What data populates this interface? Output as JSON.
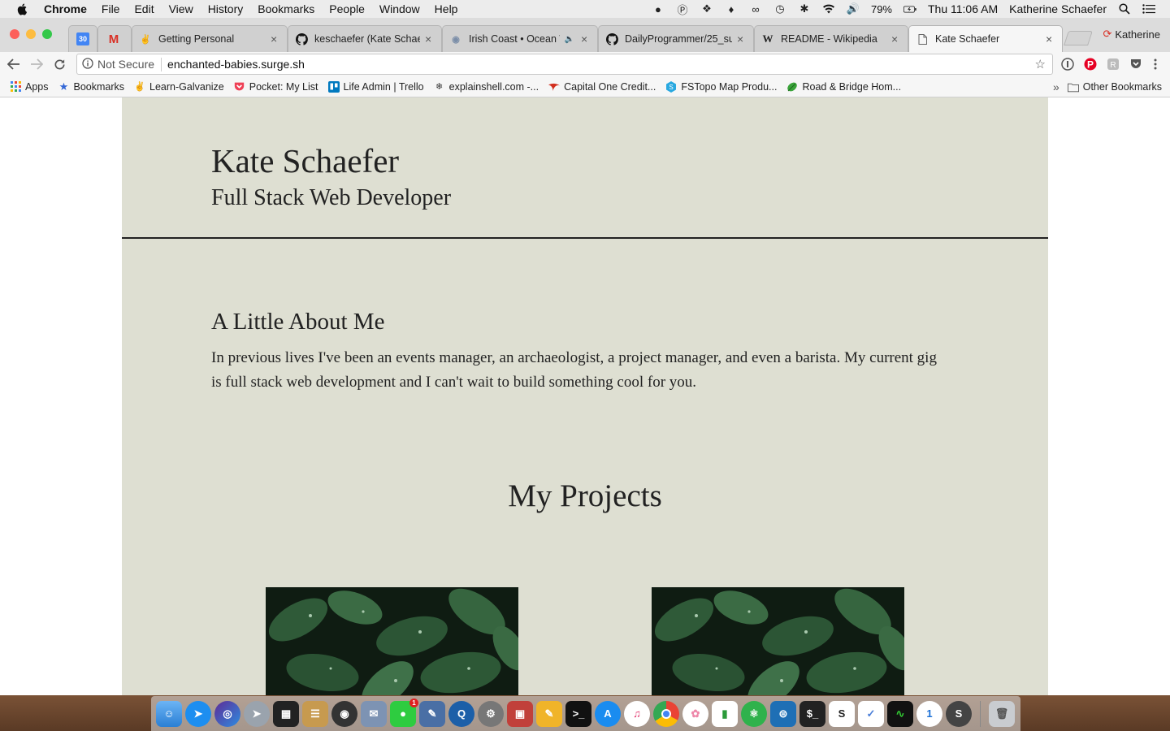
{
  "menubar": {
    "app_name": "Chrome",
    "menus": [
      "File",
      "Edit",
      "View",
      "History",
      "Bookmarks",
      "People",
      "Window",
      "Help"
    ],
    "battery": "79%",
    "clock": "Thu 11:06 AM",
    "user": "Katherine Schaefer"
  },
  "tabs": [
    {
      "label": "",
      "icon": "calendar-icon"
    },
    {
      "label": "",
      "icon": "gmail-icon"
    },
    {
      "label": "Getting Personal",
      "icon": "hand-icon"
    },
    {
      "label": "keschaefer (Kate Schaefer)",
      "icon": "github-icon"
    },
    {
      "label": "Irish Coast • Ocean Waves",
      "icon": "globe-icon"
    },
    {
      "label": "DailyProgrammer/25_su",
      "icon": "github-icon"
    },
    {
      "label": "README - Wikipedia",
      "icon": "wikipedia-icon"
    },
    {
      "label": "Kate Schaefer",
      "icon": "document-icon"
    }
  ],
  "profile_name": "Katherine",
  "omnibox": {
    "security": "Not Secure",
    "url": "enchanted-babies.surge.sh"
  },
  "bookmarks": {
    "items": [
      {
        "label": "Apps",
        "icon": "apps-grid-icon"
      },
      {
        "label": "Bookmarks",
        "icon": "star-icon"
      },
      {
        "label": "Learn-Galvanize",
        "icon": "hand-icon"
      },
      {
        "label": "Pocket: My List",
        "icon": "pocket-icon"
      },
      {
        "label": "Life Admin | Trello",
        "icon": "trello-icon"
      },
      {
        "label": "explainshell.com -...",
        "icon": "shell-icon"
      },
      {
        "label": "Capital One Credit...",
        "icon": "capital-one-icon"
      },
      {
        "label": "FSTopo Map Produ...",
        "icon": "map-icon"
      },
      {
        "label": "Road & Bridge Hom...",
        "icon": "leaf-icon"
      }
    ],
    "overflow": "»",
    "other": "Other Bookmarks"
  },
  "site": {
    "name": "Kate Schaefer",
    "role": "Full Stack Web Developer",
    "about_heading": "A Little About Me",
    "about_text": "In previous lives I've been an events manager, an archaeologist, a project manager, and even a barista. My current gig is full stack web development and I can't wait to build something cool for you.",
    "projects_heading": "My Projects"
  },
  "dock": {
    "messages_badge": "1"
  },
  "colors": {
    "site_bg": "#dedfd2",
    "divider": "#222222",
    "page_bg": "#ffffff"
  }
}
